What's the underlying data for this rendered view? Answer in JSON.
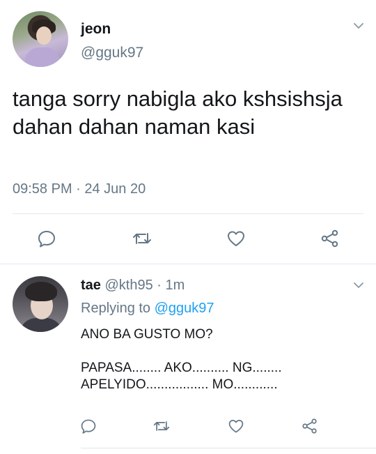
{
  "main_tweet": {
    "name": "jeon",
    "handle": "@gguk97",
    "text": "tanga sorry nabigla ako kshsishsja dahan dahan naman kasi",
    "timestamp": "09:58 PM · 24 Jun 20",
    "icons": {
      "menu": "chevron-down-icon",
      "reply": "reply-icon",
      "retweet": "retweet-icon",
      "like": "heart-icon",
      "share": "share-icon"
    }
  },
  "reply_tweet": {
    "name": "tae",
    "handle": "@kth95",
    "separator": "·",
    "age": "1m",
    "replying_prefix": "Replying to",
    "replying_to": "@gguk97",
    "text": "ANO BA GUSTO MO?\n\nPAPASA........ AKO.......... NG........\nAPELYIDO................. MO............"
  },
  "colors": {
    "text": "#14171a",
    "secondary": "#657786",
    "link": "#1da1f2",
    "divider": "#e1e8ed"
  }
}
